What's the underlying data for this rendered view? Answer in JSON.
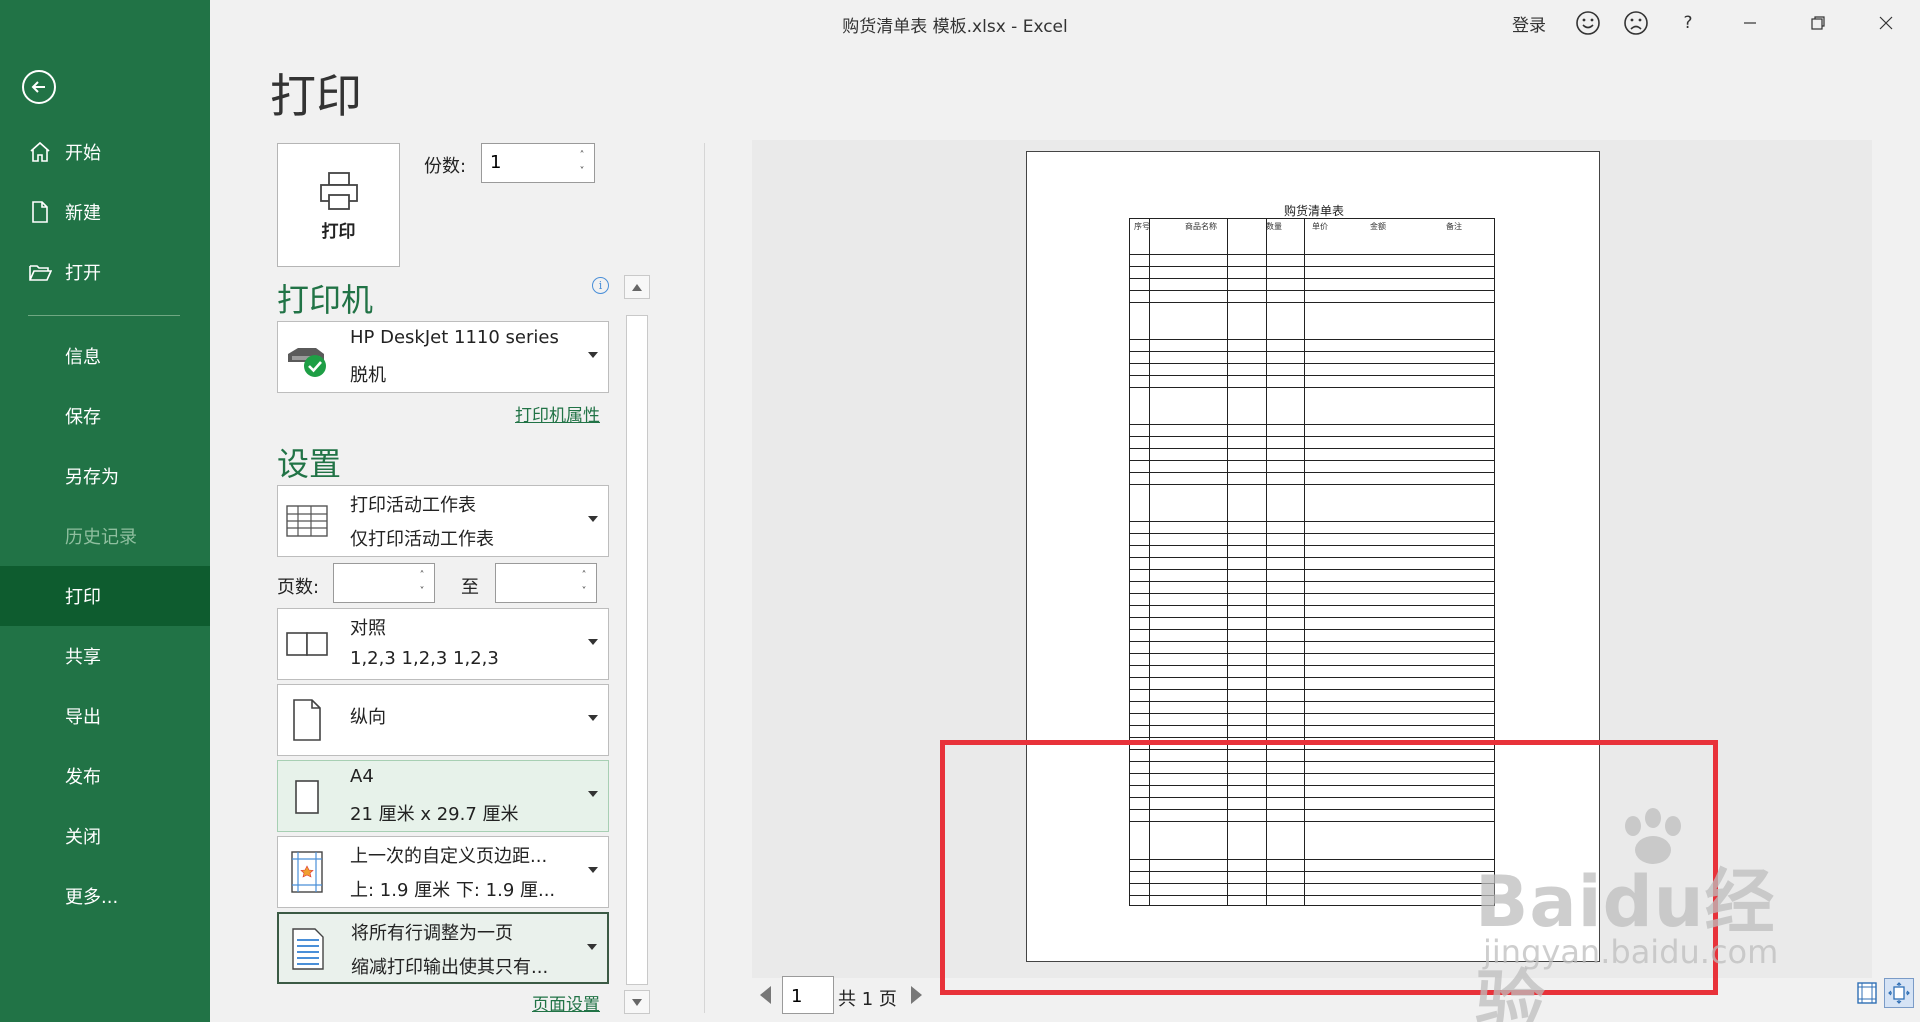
{
  "window": {
    "title": "购货清单表 模板.xlsx  -  Excel",
    "signin": "登录",
    "help": "?"
  },
  "sidebar": {
    "back_icon": "back-arrow-icon",
    "items": [
      {
        "label": "开始",
        "icon": "home-icon"
      },
      {
        "label": "新建",
        "icon": "new-document-icon"
      },
      {
        "label": "打开",
        "icon": "open-folder-icon"
      },
      {
        "label": "信息"
      },
      {
        "label": "保存"
      },
      {
        "label": "另存为"
      },
      {
        "label": "历史记录",
        "state": "disabled"
      },
      {
        "label": "打印",
        "state": "active"
      },
      {
        "label": "共享"
      },
      {
        "label": "导出"
      },
      {
        "label": "发布"
      },
      {
        "label": "关闭"
      },
      {
        "label": "更多..."
      }
    ]
  },
  "print": {
    "title": "打印",
    "button_label": "打印",
    "copies_label": "份数:",
    "copies_value": "1",
    "printer_heading": "打印机",
    "printer": {
      "name": "HP DeskJet 1110 series",
      "status": "脱机"
    },
    "printer_properties": "打印机属性",
    "settings_heading": "设置",
    "settings": {
      "scope": {
        "line1": "打印活动工作表",
        "line2": "仅打印活动工作表"
      },
      "pages_label": "页数:",
      "pages_from": "",
      "pages_to_label": "至",
      "pages_to": "",
      "collate": {
        "line1": "对照",
        "line2": "1,2,3     1,2,3     1,2,3"
      },
      "orientation": {
        "line1": "纵向"
      },
      "paper": {
        "line1": "A4",
        "line2": "21 厘米 x 29.7 厘米"
      },
      "margins": {
        "line1": "上一次的自定义页边距...",
        "line2": "上: 1.9 厘米 下: 1.9 厘..."
      },
      "scaling": {
        "line1": "将所有行调整为一页",
        "line2": "缩减打印输出使其只有..."
      }
    },
    "page_setup": "页面设置"
  },
  "preview": {
    "sheet_title": "购货清单表",
    "headers": [
      "序号",
      "商品名称",
      "数量",
      "单价",
      "金额",
      "备注"
    ],
    "current_page": "1",
    "total_pages": "共 1 页"
  },
  "watermark": {
    "brand": "Baidu经验",
    "url": "jingyan.baidu.com"
  },
  "colors": {
    "accent": "#217346",
    "sidebar_active": "#0e5c2f",
    "highlight": "#e8323a"
  }
}
